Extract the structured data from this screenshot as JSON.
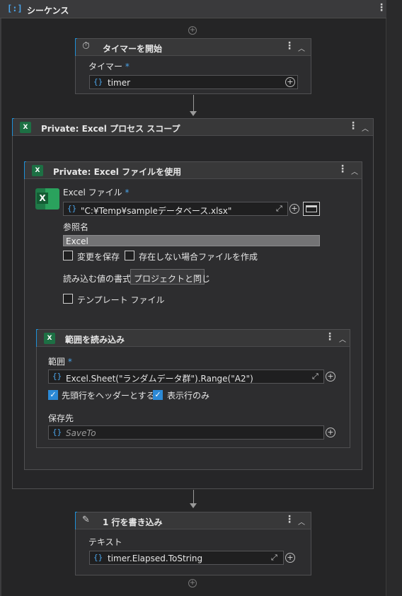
{
  "sequence": {
    "title": "シーケンス"
  },
  "start_timer": {
    "title": "タイマーを開始",
    "field_label": "タイマー",
    "required_mark": "*",
    "field_value": "timer"
  },
  "excel_scope": {
    "title": "Private: Excel プロセス スコープ"
  },
  "use_excel": {
    "title": "Private: Excel ファイルを使用",
    "file_label": "Excel ファイル",
    "required_mark": "*",
    "file_value": "\"C:¥Temp¥sampleデータベース.xlsx\"",
    "ref_label": "参照名",
    "ref_value": "Excel",
    "save_changes": "変更を保存",
    "create_if_missing": "存在しない場合ファイルを作成",
    "read_format_label": "読み込む値の書式",
    "read_format_value": "プロジェクトと同じ",
    "template_file": "テンプレート ファイル"
  },
  "read_range": {
    "title": "範囲を読み込み",
    "range_label": "範囲",
    "required_mark": "*",
    "range_value": "Excel.Sheet(\"ランダムデータ群\").Range(\"A2\")",
    "first_row_header": "先頭行をヘッダーとする",
    "visible_rows_only": "表示行のみ",
    "save_to_label": "保存先",
    "save_to_placeholder": "SaveTo"
  },
  "write_line": {
    "title": "1 行を書き込み",
    "text_label": "テキスト",
    "text_value": "timer.Elapsed.ToString"
  },
  "glyphs": {
    "brace": "{}",
    "plus": "+",
    "kebab": "⋮",
    "chevron": "︿",
    "check": "✓",
    "expand": "⤢",
    "caret": "⌄"
  }
}
